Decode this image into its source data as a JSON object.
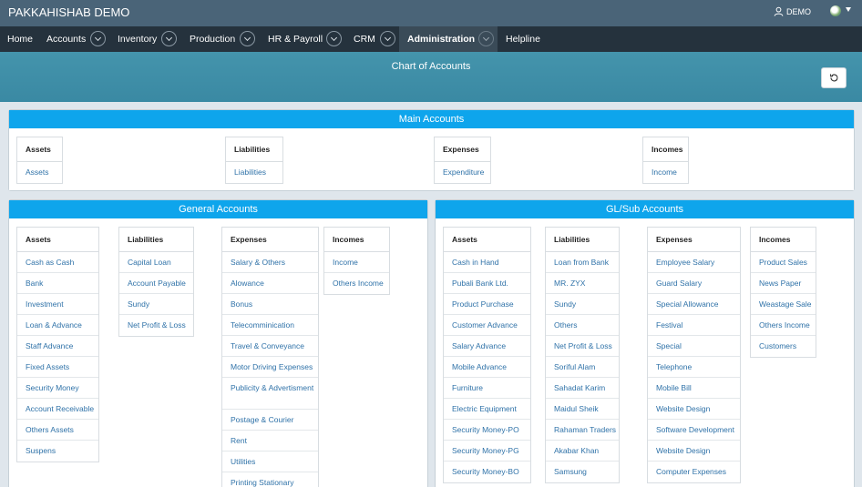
{
  "app": {
    "brand": "PAKKAHISHAB DEMO",
    "user": "DEMO"
  },
  "nav": {
    "items": [
      {
        "label": "Home"
      },
      {
        "label": "Accounts"
      },
      {
        "label": "Inventory"
      },
      {
        "label": "Production"
      },
      {
        "label": "HR & Payroll"
      },
      {
        "label": "CRM"
      },
      {
        "label": "Administration"
      },
      {
        "label": "Helpline"
      }
    ]
  },
  "page": {
    "title": "Chart of Accounts"
  },
  "main": {
    "title": "Main Accounts",
    "groups": [
      {
        "header": "Assets",
        "items": [
          "Assets"
        ]
      },
      {
        "header": "Liabilities",
        "items": [
          "Liabilities"
        ]
      },
      {
        "header": "Expenses",
        "items": [
          "Expenditure"
        ]
      },
      {
        "header": "Incomes",
        "items": [
          "Income"
        ]
      }
    ]
  },
  "general": {
    "title": "General Accounts",
    "groups": [
      {
        "header": "Assets",
        "items": [
          "Cash as Cash",
          "Bank",
          "Investment",
          "Loan & Advance",
          "Staff Advance",
          "Fixed Assets",
          "Security Money",
          "Account Receivable",
          "Others Assets",
          "Suspens"
        ]
      },
      {
        "header": "Liabilities",
        "items": [
          "Capital Loan",
          "Account Payable",
          "Sundy",
          "Net Profit & Loss"
        ]
      },
      {
        "header": "Expenses",
        "items": [
          "Salary & Others",
          "Alowance",
          "Bonus",
          "Telecomminication",
          "Travel & Conveyance",
          "Motor Driving Expenses",
          "Publicity & Advertisment",
          "Postage & Courier",
          "Rent",
          "Utilities",
          "Printing Stationary"
        ]
      },
      {
        "header": "Incomes",
        "items": [
          "Income",
          "Others Income"
        ]
      }
    ]
  },
  "gl": {
    "title": "GL/Sub Accounts",
    "groups": [
      {
        "header": "Assets",
        "items": [
          "Cash in Hand",
          "Pubali Bank Ltd.",
          "Product Purchase",
          "Customer Advance",
          "Salary Advance",
          "Mobile Advance",
          "Furniture",
          "Electric Equipment",
          "Security Money-PO",
          "Security Money-PG",
          "Security Money-BO"
        ]
      },
      {
        "header": "Liabilities",
        "items": [
          "Loan from Bank",
          "MR. ZYX",
          "Sundy",
          "Others",
          "Net Profit & Loss",
          "Soriful Alam",
          "Sahadat Karim",
          "Maidul Sheik",
          "Rahaman Traders",
          "Akabar Khan",
          "Samsung"
        ]
      },
      {
        "header": "Expenses",
        "items": [
          "Employee Salary",
          "Guard Salary",
          "Special Allowance",
          "Festival",
          "Special",
          "Telephone",
          "Mobile Bill",
          "Website Design",
          "Software Development",
          "Website Design",
          "Computer Expenses"
        ]
      },
      {
        "header": "Incomes",
        "items": [
          "Product Sales",
          "News Paper",
          "Weastage Sale",
          "Others Income",
          "Customers"
        ]
      }
    ]
  }
}
